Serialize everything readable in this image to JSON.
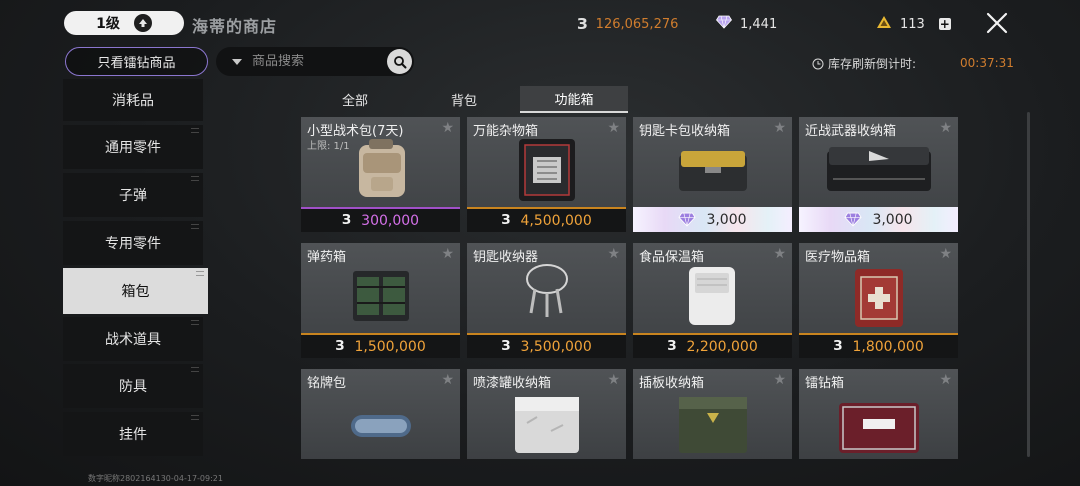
{
  "header": {
    "level": "1级",
    "shop_title": "海蒂的商店",
    "coins": "126,065,276",
    "diamonds": "1,441",
    "tri_currency": "113",
    "plus": "+"
  },
  "toolbar": {
    "filter_button": "只看镭钻商品",
    "search_placeholder": "商品搜索",
    "refresh_label": "库存刷新倒计时:",
    "refresh_time": "00:37:31"
  },
  "sidebar": {
    "items": [
      {
        "label": "消耗品"
      },
      {
        "label": "通用零件"
      },
      {
        "label": "子弹"
      },
      {
        "label": "专用零件"
      },
      {
        "label": "箱包",
        "active": true
      },
      {
        "label": "战术道具"
      },
      {
        "label": "防具"
      },
      {
        "label": "挂件"
      }
    ],
    "footer_id": "数字昵称2802164130-04-17-09:21"
  },
  "tabs": [
    {
      "label": "全部"
    },
    {
      "label": "背包"
    },
    {
      "label": "功能箱",
      "active": true
    }
  ],
  "currency_glyph": "З",
  "star_glyph": "★",
  "items": [
    {
      "name": "小型战术包(7天)",
      "limit": "上限: 1/1",
      "price": "300,000",
      "currency": "coin",
      "bar": "purple",
      "icon": "tactical-pouch-icon"
    },
    {
      "name": "万能杂物箱",
      "price": "4,500,000",
      "currency": "coin",
      "bar": "gold",
      "icon": "utility-case-icon"
    },
    {
      "name": "钥匙卡包收纳箱",
      "price": "3,000",
      "currency": "diamond",
      "bar": "holo",
      "icon": "keycard-case-icon"
    },
    {
      "name": "近战武器收纳箱",
      "price": "3,000",
      "currency": "diamond",
      "bar": "holo",
      "icon": "melee-case-icon"
    },
    {
      "name": "弹药箱",
      "price": "1,500,000",
      "currency": "coin",
      "bar": "gold",
      "icon": "ammo-box-icon"
    },
    {
      "name": "钥匙收纳器",
      "price": "3,500,000",
      "currency": "coin",
      "bar": "gold",
      "icon": "key-ring-icon"
    },
    {
      "name": "食品保温箱",
      "price": "2,200,000",
      "currency": "coin",
      "bar": "gold",
      "icon": "food-cooler-icon"
    },
    {
      "name": "医疗物品箱",
      "price": "1,800,000",
      "currency": "coin",
      "bar": "gold",
      "icon": "medical-case-icon"
    },
    {
      "name": "铭牌包",
      "icon": "dogtag-case-icon"
    },
    {
      "name": "喷漆罐收纳箱",
      "icon": "spray-case-icon"
    },
    {
      "name": "插板收纳箱",
      "icon": "plate-case-icon"
    },
    {
      "name": "镭钻箱",
      "icon": "diamond-case-icon"
    }
  ],
  "colors": {
    "coin": "#d07d2e",
    "gold_bar": "#c9841f",
    "purple_bar": "#a050c8",
    "filter_border": "#8b76cf"
  }
}
